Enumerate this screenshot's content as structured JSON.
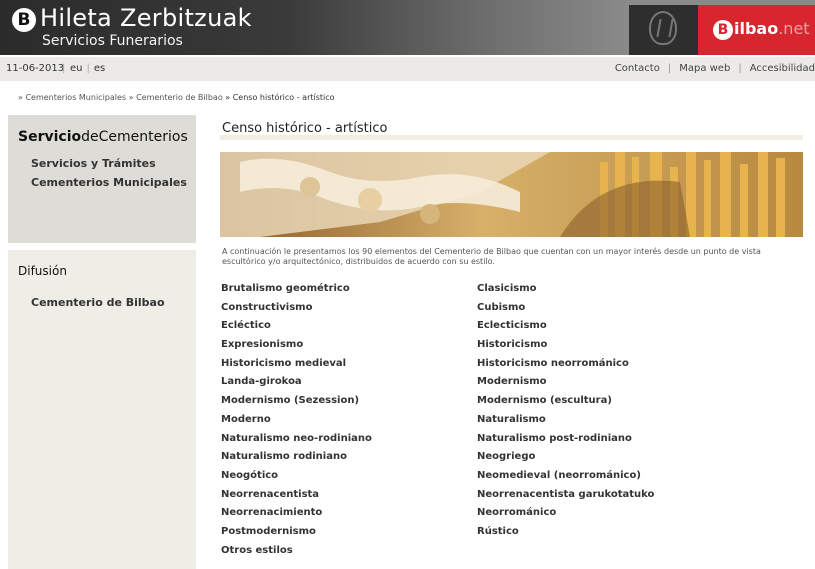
{
  "header": {
    "logo_letter": "B",
    "title": "Hileta Zerbitzuak",
    "subtitle": "Servicios Funerarios",
    "bilbao_letter": "B",
    "bilbao_text": "ilbao",
    "bilbao_suffix": ".net"
  },
  "utility": {
    "date": "11-06-2013",
    "languages": [
      "eu",
      "es"
    ],
    "links": [
      "Contacto",
      "Mapa web",
      "Accesibilidad"
    ]
  },
  "breadcrumb": {
    "items": [
      "» Cementerios Municipales",
      "» Cementerio de Bilbao",
      "» Censo histórico - artístico"
    ]
  },
  "sidebar": {
    "service_title_bold": "Servicio",
    "service_title_rest": "deCementerios",
    "service_links": [
      "Servicios y Trámites",
      "Cementerios Municipales"
    ],
    "difusion_heading": "Difusión",
    "difusion_links": [
      "Cementerio de Bilbao"
    ]
  },
  "main": {
    "title": "Censo histórico - artístico",
    "intro": "A continuación le presentamos los 90 elementos del Cementerio de Bilbao que cuentan con un mayor interés desde un punto de vista escultórico y/o arquitectónico, distribuidos de acuerdo con su estilo.",
    "styles_col1": [
      "Brutalismo geométrico",
      "Constructivismo",
      "Ecléctico",
      "Expresionismo",
      "Historicismo medieval",
      "Landa-girokoa",
      "Modernismo (Sezession)",
      "Moderno",
      "Naturalismo neo-rodiniano",
      "Naturalismo rodiniano",
      "Neogótico",
      "Neorrenacentista",
      "Neorrenacimiento",
      "Postmodernismo",
      "Otros estilos"
    ],
    "styles_col2": [
      "Clasicismo",
      "Cubismo",
      "Eclecticismo",
      "Historicismo",
      "Historicismo neorrománico",
      "Modernismo",
      "Modernismo (escultura)",
      "Naturalismo",
      "Naturalismo post-rodiniano",
      "Neogriego",
      "Neomedieval (neorrománico)",
      "Neorrenacentista garukotatuko",
      "Neorrománico",
      "Rústico"
    ]
  }
}
